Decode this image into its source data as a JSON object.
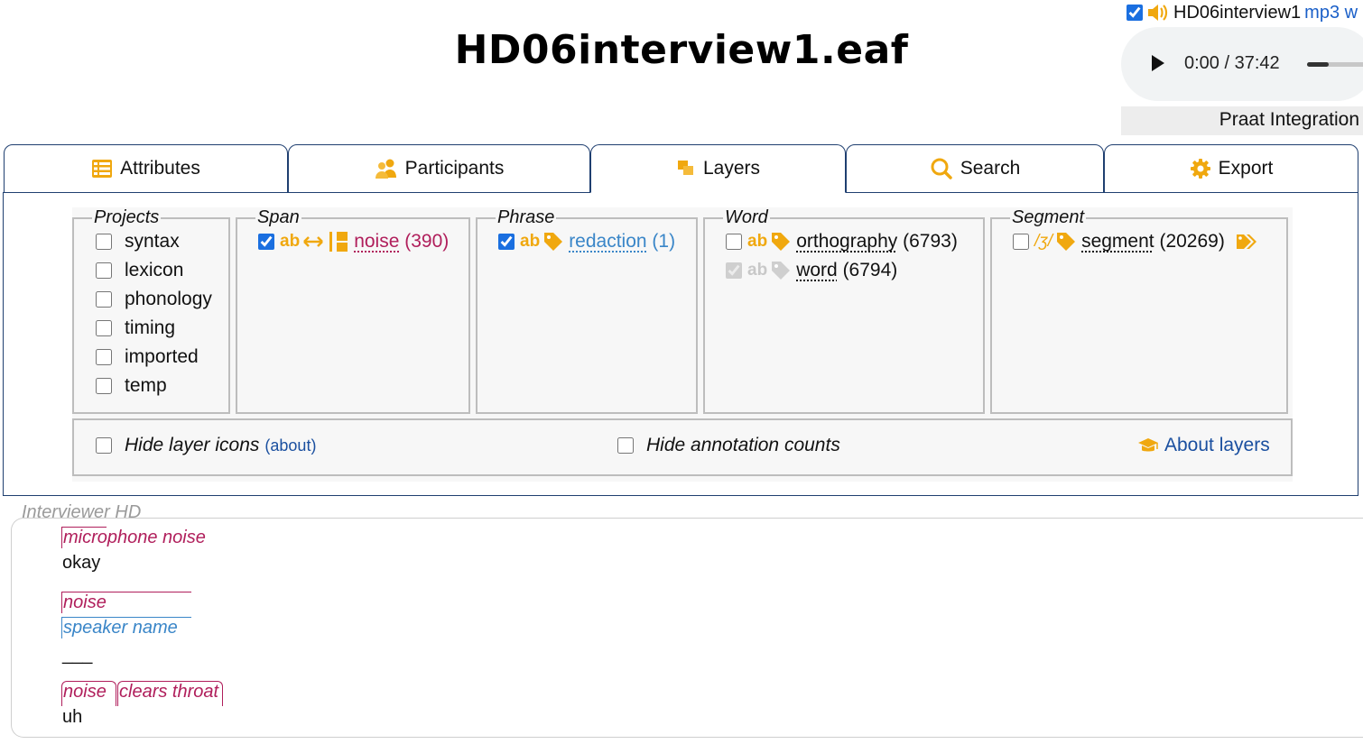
{
  "page": {
    "title": "HD06interview1.eaf"
  },
  "media": {
    "checked": true,
    "file_name": "HD06interview1",
    "file_type": "mp3 w",
    "time": "0:00 / 37:42",
    "progress_fraction": 0.0,
    "praat_label": "Praat Integration"
  },
  "tabs": [
    {
      "label": "Attributes",
      "icon": "table-icon"
    },
    {
      "label": "Participants",
      "icon": "people-icon"
    },
    {
      "label": "Layers",
      "icon": "layers-icon",
      "active": true
    },
    {
      "label": "Search",
      "icon": "search-icon"
    },
    {
      "label": "Export",
      "icon": "gear-icon"
    }
  ],
  "layers": {
    "projects": {
      "legend": "Projects",
      "items": [
        "syntax",
        "lexicon",
        "phonology",
        "timing",
        "imported",
        "temp"
      ]
    },
    "span": {
      "legend": "Span",
      "items": [
        {
          "name": "noise",
          "count": "(390)",
          "checked": true,
          "ab": "ab"
        }
      ]
    },
    "phrase": {
      "legend": "Phrase",
      "items": [
        {
          "name": "redaction",
          "count": "(1)",
          "checked": true,
          "ab": "ab"
        }
      ]
    },
    "word": {
      "legend": "Word",
      "items": [
        {
          "name": "orthography",
          "count": "(6793)",
          "checked": false,
          "ab": "ab"
        },
        {
          "name": "word",
          "count": "(6794)",
          "checked": true,
          "disabled": true,
          "ab": "ab"
        }
      ]
    },
    "segment": {
      "legend": "Segment",
      "items": [
        {
          "name": "segment",
          "count": "(20269)",
          "checked": false,
          "ipa": "/ʒ/"
        }
      ]
    },
    "options": {
      "hide_icons": "Hide layer icons",
      "about_small": "(about)",
      "hide_counts": "Hide annotation counts",
      "about_layers": "About layers"
    }
  },
  "colors": {
    "accent": "#f0a80f",
    "span": "#b01e5b",
    "phrase": "#3a86c8",
    "border": "#1f3f70"
  },
  "transcript": {
    "participant": "Interviewer HD",
    "lines": [
      {
        "annotations": [
          "microphone noise"
        ],
        "word": "okay"
      },
      {
        "annotations": [
          "noise",
          "speaker name"
        ],
        "word": "___"
      },
      {
        "annotations": [
          "noise",
          "clears throat"
        ],
        "word": "uh"
      }
    ]
  }
}
